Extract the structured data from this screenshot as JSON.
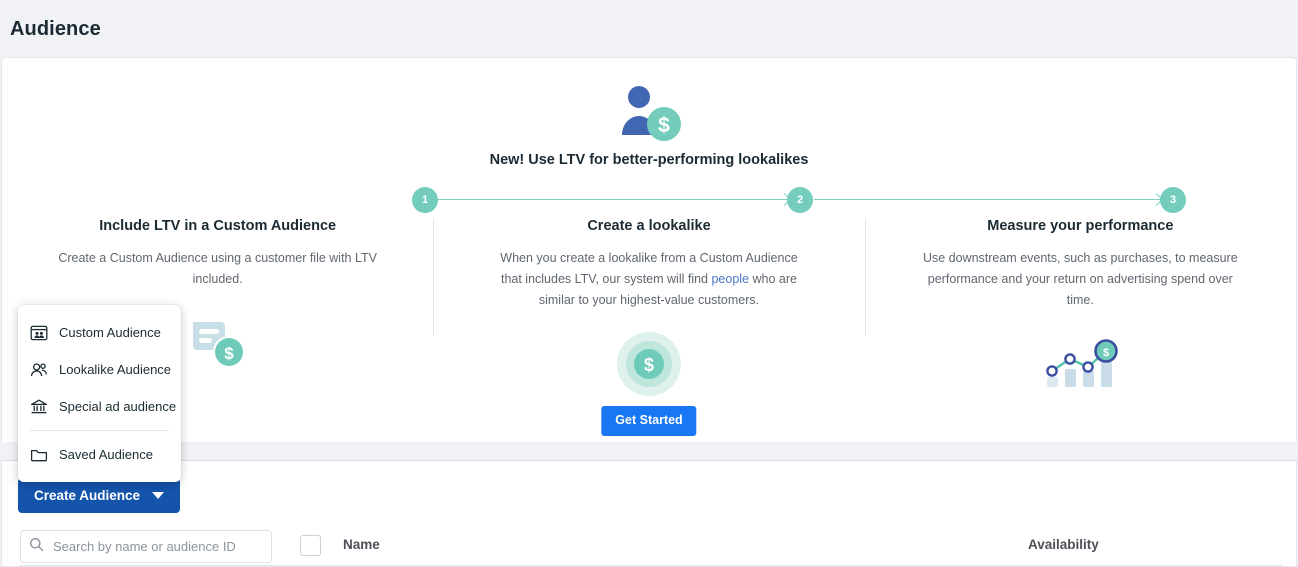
{
  "header": {
    "title": "Audience"
  },
  "promo": {
    "hero_icon": "person-with-dollar-icon",
    "headline": "New! Use LTV for better-performing lookalikes",
    "cta_label": "Get Started",
    "accent_color": "#74cdbc",
    "cta_color": "#1877f2",
    "steps": [
      {
        "number": "1",
        "title": "Include LTV in a Custom Audience",
        "body": "Create a Custom Audience using a customer file with LTV included.",
        "art": "document-with-dollar-icon"
      },
      {
        "number": "2",
        "title": "Create a lookalike",
        "body_before_link": "When you create a lookalike from a Custom Audience that includes LTV, our system will find ",
        "link_text": "people",
        "body_after_link": " who are similar to your highest-value customers.",
        "art": "dollar-target-icon",
        "link_color": "#4a76c4"
      },
      {
        "number": "3",
        "title": "Measure your performance",
        "body": "Use downstream events, such as purchases, to measure performance and your return on advertising spend over time.",
        "art": "bar-chart-with-dollar-icon"
      }
    ]
  },
  "dropdown": {
    "items": [
      {
        "label": "Custom Audience",
        "icon": "custom-audience-icon"
      },
      {
        "label": "Lookalike Audience",
        "icon": "lookalike-audience-icon"
      },
      {
        "label": "Special ad audience",
        "icon": "bank-icon"
      },
      {
        "label": "Saved Audience",
        "icon": "folder-icon"
      }
    ]
  },
  "toolbar": {
    "create_label": "Create Audience",
    "create_color": "#1454ab",
    "caret_icon": "chevron-down-icon",
    "search_icon": "search-icon",
    "search_placeholder": "Search by name or audience ID",
    "search_value": ""
  },
  "table": {
    "columns": [
      {
        "label": "Name"
      },
      {
        "label": "Availability"
      }
    ]
  }
}
